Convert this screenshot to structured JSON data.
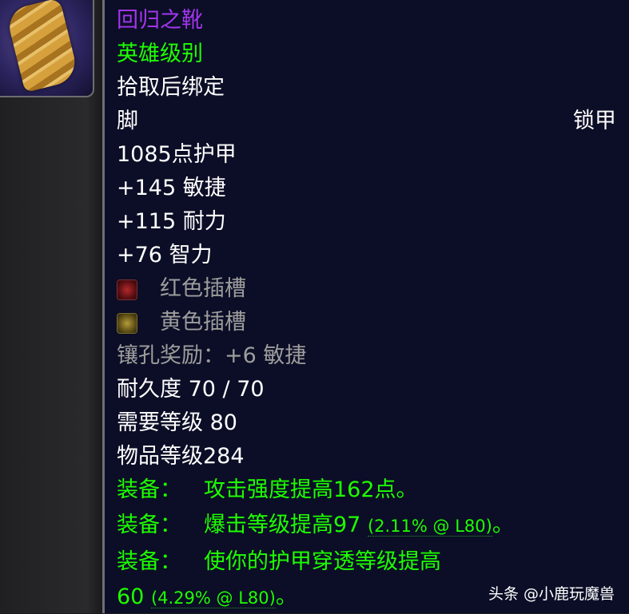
{
  "item": {
    "name": "回归之靴",
    "difficulty": "英雄级别",
    "binding": "拾取后绑定",
    "slot": "脚",
    "armor_type": "锁甲",
    "armor": "1085点护甲",
    "stats": [
      "+145 敏捷",
      "+115 耐力",
      "+76 智力"
    ],
    "sockets": [
      {
        "label": "红色插槽",
        "icon": "red-socket-icon"
      },
      {
        "label": "黄色插槽",
        "icon": "yellow-socket-icon"
      }
    ],
    "socket_bonus": "镶孔奖励：+6 敏捷",
    "durability": "耐久度 70 / 70",
    "required_level": "需要等级 80",
    "item_level": "物品等级284",
    "equip": [
      {
        "label": "装备：",
        "text": "攻击强度提高162点。",
        "extra": ""
      },
      {
        "label": "装备：",
        "text": "爆击等级提高97",
        "extra": "(2.11% @ L80)",
        "suffix": "。"
      },
      {
        "label": "装备：",
        "text": "使你的护甲穿透等级提高",
        "continuation": "60",
        "extra": "(4.29% @ L80)",
        "suffix": "。"
      }
    ]
  },
  "watermark": "头条 @小鹿玩魔兽",
  "colors": {
    "epic": "#a335ee",
    "green": "#1eff00",
    "gray": "#9d9d9d",
    "tooltip_bg": "#0b0e26"
  }
}
